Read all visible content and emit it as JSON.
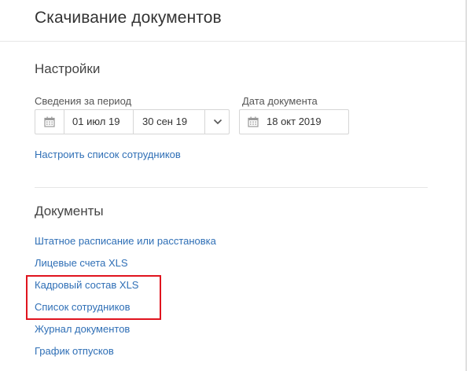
{
  "header": {
    "title": "Скачивание документов"
  },
  "settings": {
    "title": "Настройки",
    "period": {
      "label": "Сведения за период",
      "from": "01 июл 19",
      "to": "30 сен 19"
    },
    "document_date": {
      "label": "Дата документа",
      "value": "18 окт 2019"
    },
    "setup_link": "Настроить список сотрудников"
  },
  "documents": {
    "title": "Документы",
    "links": [
      "Штатное расписание или расстановка",
      "Лицевые счета XLS",
      "Кадровый состав XLS",
      "Список сотрудников",
      "Журнал документов",
      "График отпусков"
    ]
  },
  "colors": {
    "link": "#2f6fb6",
    "highlight": "#e0141e",
    "border": "#d6d6d6",
    "icon": "#9a9a9a"
  },
  "icons": {
    "period_calendar": "calendar-icon",
    "period_dropdown": "chevron-down-icon",
    "date_calendar": "calendar-icon"
  }
}
